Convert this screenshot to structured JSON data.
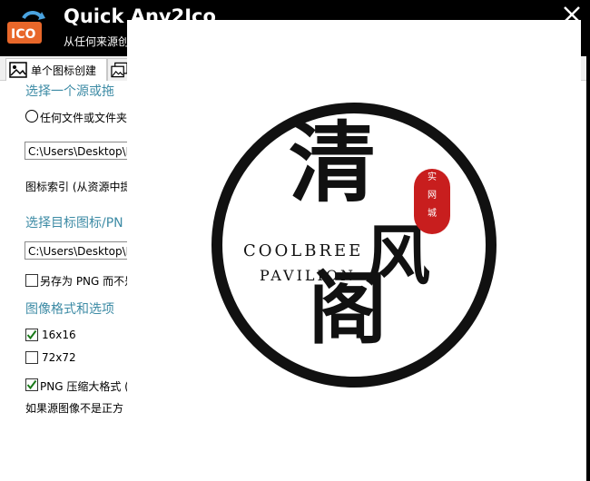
{
  "header": {
    "title": "Quick Any2Ico",
    "subtitle": "从任何来源创"
  },
  "tabs": [
    {
      "label": "单个图标创建"
    },
    {
      "label": ""
    }
  ],
  "form": {
    "section_source": "选择一个源或拖",
    "radio_any_file_label": "任何文件或文件夹",
    "source_path": "C:\\Users\\Desktop\\IC",
    "icon_index_label": "图标索引 (从资源中提",
    "section_target": "选择目标图标/PN",
    "target_path": "C:\\Users\\Desktop\\IC",
    "save_png_label": "另存为 PNG 而不是",
    "section_format": "图像格式和选项",
    "size_16_label": "16x16",
    "size_16_checked": true,
    "size_72_label": "72x72",
    "size_72_checked": false,
    "png_compress_label": "PNG 压缩大格式 (",
    "png_compress_checked": true,
    "non_square_label": "如果源图像不是正方"
  },
  "preview": {
    "logo_line1": "COOLBREE",
    "logo_line2": "PAVILION",
    "char_1": "清",
    "char_2": "风",
    "char_3": "阁",
    "seal_chars": [
      "实",
      "网",
      "城"
    ]
  },
  "colors": {
    "accent": "#3d8ba5",
    "seal": "#c81e1e"
  }
}
